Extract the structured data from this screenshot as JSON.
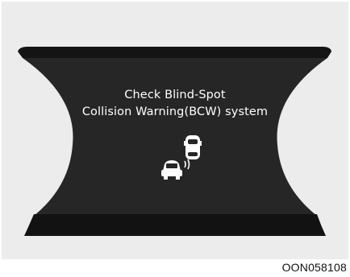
{
  "warning": {
    "line1": "Check Blind-Spot",
    "line2": "Collision Warning(BCW) system",
    "icon": "bcw-vehicles-icon"
  },
  "figure_code": "OON058108",
  "colors": {
    "background": "#ececec",
    "display_dark": "#222222",
    "display_band": "#141414",
    "text": "#ffffff"
  }
}
